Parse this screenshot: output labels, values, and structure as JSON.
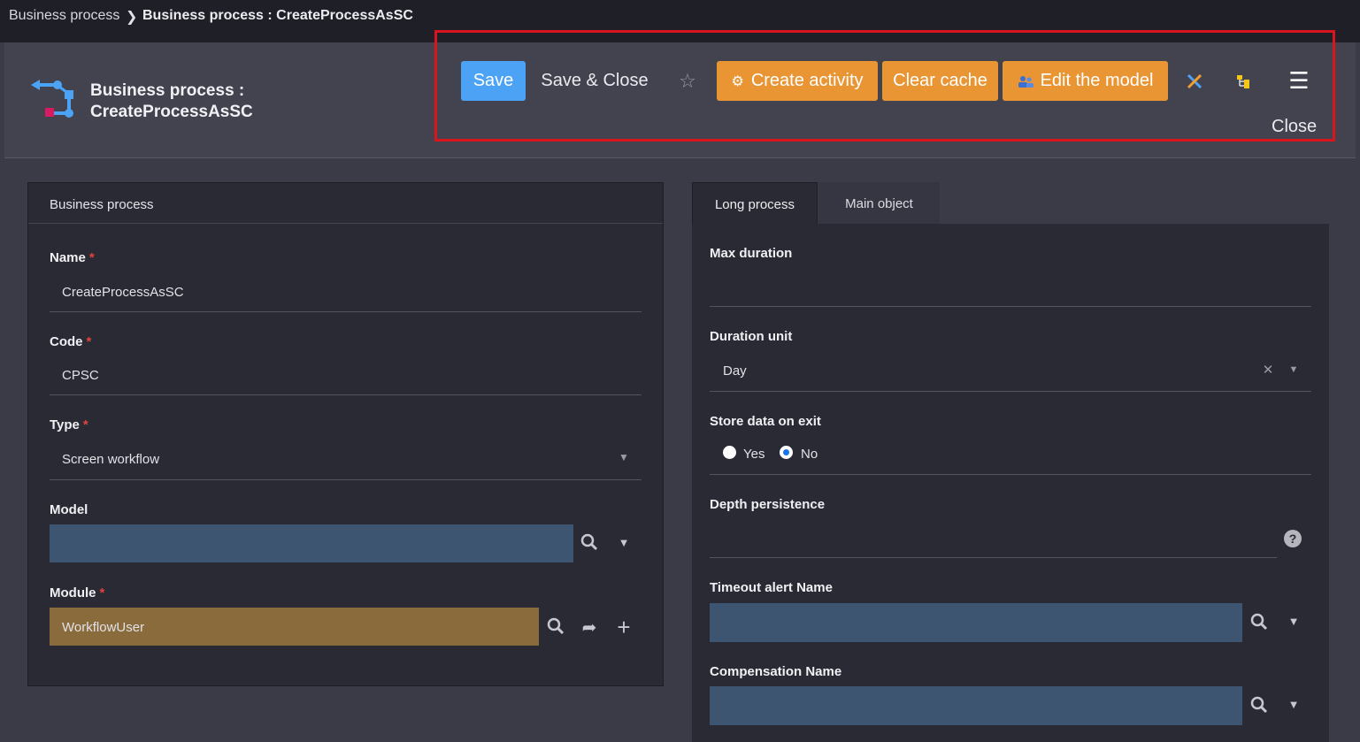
{
  "breadcrumb": {
    "parent": "Business process",
    "separator": "❯",
    "current": "Business process : CreateProcessAsSC"
  },
  "header": {
    "title_line1": "Business process :",
    "title_line2": "CreateProcessAsSC"
  },
  "toolbar": {
    "save": "Save",
    "save_close": "Save & Close",
    "create_activity": "Create activity",
    "clear_cache": "Clear cache",
    "edit_model": "Edit the model",
    "close": "Close",
    "icons": [
      "star-icon",
      "gear-icon",
      "users-icon",
      "tools-icon",
      "tree-icon",
      "menu-icon"
    ],
    "accent_color": "#4ca3f6",
    "action_color": "#ea9533"
  },
  "left_panel": {
    "title": "Business process",
    "name_label": "Name",
    "name_value": "CreateProcessAsSC",
    "code_label": "Code",
    "code_value": "CPSC",
    "type_label": "Type",
    "type_value": "Screen workflow",
    "model_label": "Model",
    "module_label": "Module",
    "module_value": "WorkflowUser",
    "required_mark": "*"
  },
  "right_panel": {
    "tabs": [
      "Long process",
      "Main object"
    ],
    "max_duration_label": "Max duration",
    "duration_unit_label": "Duration unit",
    "duration_unit_value": "Day",
    "store_data_label": "Store data on exit",
    "radio_yes": "Yes",
    "radio_no": "No",
    "depth_label": "Depth persistence",
    "timeout_label": "Timeout alert Name",
    "compensation_label": "Compensation Name"
  }
}
